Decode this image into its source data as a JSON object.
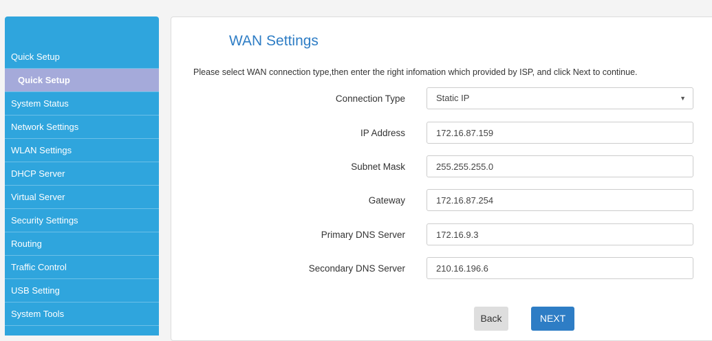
{
  "sidebar": {
    "items": [
      {
        "label": "Quick Setup"
      },
      {
        "label": "Quick Setup"
      },
      {
        "label": "System Status"
      },
      {
        "label": "Network Settings"
      },
      {
        "label": "WLAN Settings"
      },
      {
        "label": "DHCP Server"
      },
      {
        "label": "Virtual Server"
      },
      {
        "label": "Security Settings"
      },
      {
        "label": "Routing"
      },
      {
        "label": "Traffic Control"
      },
      {
        "label": "USB Setting"
      },
      {
        "label": "System Tools"
      }
    ]
  },
  "main": {
    "title": "WAN Settings",
    "description": "Please select WAN connection type,then enter the right infomation which provided by ISP, and click Next to continue.",
    "connection_type": {
      "label": "Connection Type",
      "value": "Static IP",
      "arrow": "▼"
    },
    "ip_address": {
      "label": "IP Address",
      "value": "172.16.87.159"
    },
    "subnet_mask": {
      "label": "Subnet Mask",
      "value": "255.255.255.0"
    },
    "gateway": {
      "label": "Gateway",
      "value": "172.16.87.254"
    },
    "primary_dns": {
      "label": "Primary DNS Server",
      "value": "172.16.9.3"
    },
    "secondary_dns": {
      "label": "Secondary DNS Server",
      "value": "210.16.196.6"
    },
    "back_label": "Back",
    "next_label": "NEXT"
  },
  "colors": {
    "sidebar_bg": "#2fa5dd",
    "sidebar_active": "#a5aada",
    "title": "#2e7dc5",
    "next_button": "#2e7dc5",
    "back_button": "#dedede"
  }
}
